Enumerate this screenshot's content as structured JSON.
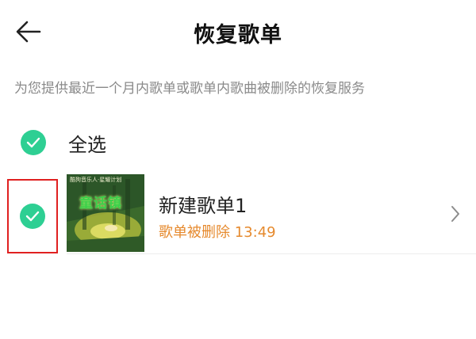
{
  "header": {
    "title": "恢复歌单",
    "back_icon": "arrow-left-icon"
  },
  "description": "为您提供最近一个月内歌单或歌单内歌曲被删除的恢复服务",
  "select_all": {
    "label": "全选",
    "checked": true
  },
  "playlists": [
    {
      "name": "新建歌单1",
      "status": "歌单被删除 13:49",
      "checked": true,
      "cover_caption": "酷狗音乐人·星耀计划",
      "cover_title": "童话镇"
    }
  ],
  "colors": {
    "accent": "#2ecf93",
    "status": "#e68a2e",
    "highlight": "#e02020"
  }
}
